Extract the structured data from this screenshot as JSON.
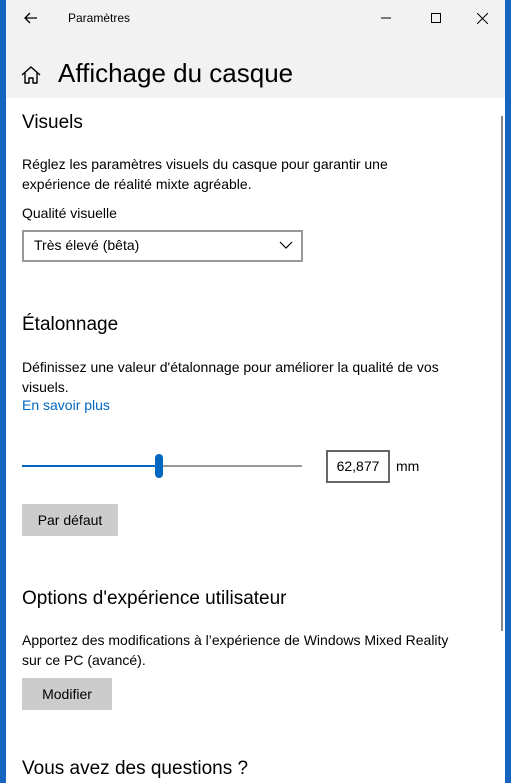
{
  "window": {
    "title": "Paramètres",
    "controls": [
      "minimize",
      "maximize",
      "close"
    ]
  },
  "header": {
    "title": "Affichage du casque"
  },
  "sections": {
    "visuals": {
      "title": "Visuels",
      "description": "Réglez les paramètres visuels du casque pour garantir une expérience de réalité mixte agréable.",
      "quality_label": "Qualité visuelle",
      "quality_value": "Très élevé (bêta)"
    },
    "calibration": {
      "title": "Étalonnage",
      "description": "Définissez une valeur d'étalonnage pour améliorer la qualité de vos visuels.",
      "learn_more": "En savoir plus",
      "slider_percent": 49,
      "value": "62,877",
      "unit": "mm",
      "default_button": "Par défaut"
    },
    "user_experience": {
      "title": "Options d'expérience utilisateur",
      "description": "Apportez des modifications à l’expérience de Windows Mixed Reality sur ce PC (avancé).",
      "modify_button": "Modifier"
    },
    "questions": {
      "title": "Vous avez des questions ?"
    }
  },
  "colors": {
    "accent": "#0067c0",
    "desktop": "#1565c0"
  }
}
